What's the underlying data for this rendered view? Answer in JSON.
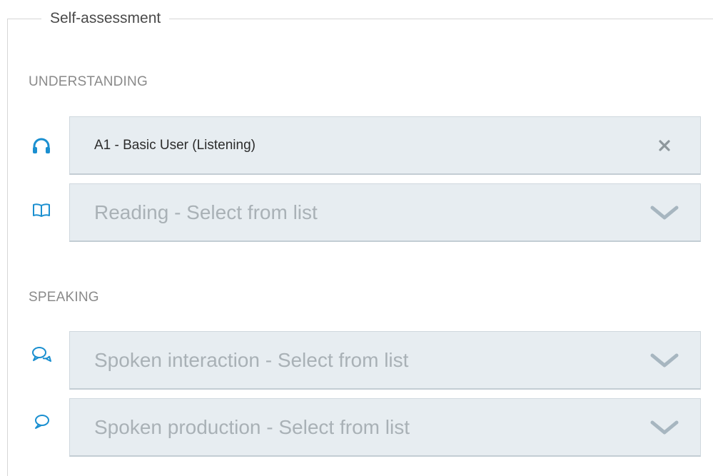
{
  "fieldset": {
    "legend": "Self-assessment"
  },
  "understanding": {
    "heading": "UNDERSTANDING",
    "listening": {
      "value": "A1 - Basic User (Listening)",
      "icon": "headphones-icon",
      "action_icon": "clear-x-icon"
    },
    "reading": {
      "placeholder": "Reading - Select from list",
      "icon": "book-icon",
      "action_icon": "chevron-down-icon"
    }
  },
  "speaking": {
    "heading": "SPEAKING",
    "spoken_interaction": {
      "placeholder": "Spoken interaction - Select from list",
      "icon": "conversation-icon",
      "action_icon": "chevron-down-icon"
    },
    "spoken_production": {
      "placeholder": "Spoken production - Select from list",
      "icon": "speech-bubble-icon",
      "action_icon": "chevron-down-icon"
    }
  },
  "colors": {
    "icon_blue": "#1a8fd0",
    "field_bg": "#e7edf1",
    "placeholder": "#a9b1b6",
    "chevron": "#a7b6c0"
  }
}
